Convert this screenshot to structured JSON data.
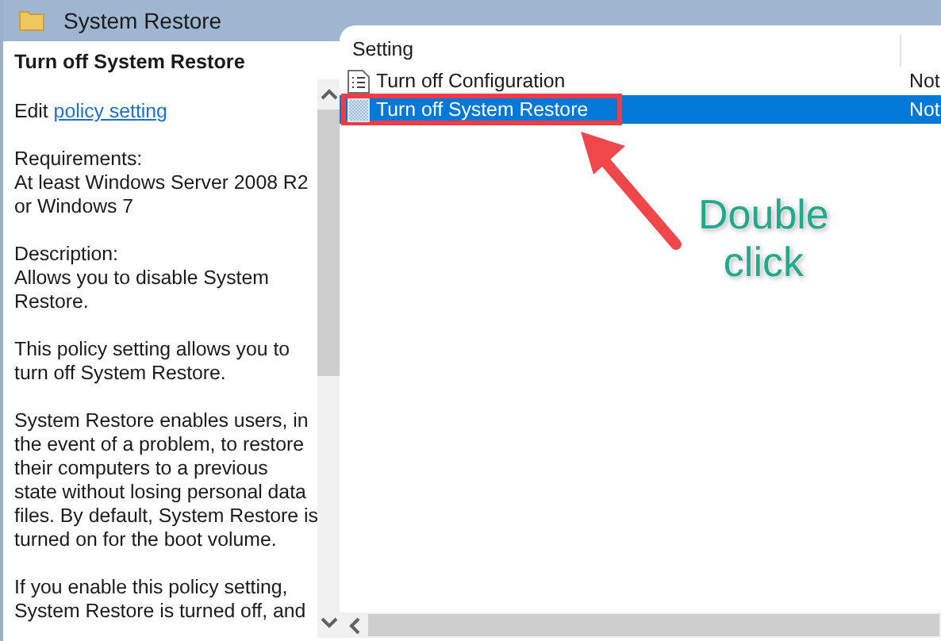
{
  "window": {
    "title": "System Restore"
  },
  "description_pane": {
    "heading": "Turn off System Restore",
    "edit_prefix": "Edit ",
    "edit_link": "policy setting",
    "paragraphs": [
      {
        "lines": [
          "Requirements:",
          "At least Windows Server 2008 R2",
          "or Windows 7"
        ]
      },
      {
        "lines": [
          "Description:",
          "Allows you to disable System",
          "Restore."
        ]
      },
      {
        "lines": [
          "This policy setting allows you to",
          "turn off System Restore."
        ]
      },
      {
        "lines": [
          "System Restore enables users, in",
          "the event of a problem, to restore",
          "their computers to a previous",
          "state without losing personal data",
          "files. By default, System Restore is",
          "turned on for the boot volume."
        ]
      },
      {
        "lines": [
          "If you enable this policy setting,",
          "System Restore is turned off, and"
        ]
      }
    ]
  },
  "settings_list": {
    "column_1": "Setting",
    "rows": [
      {
        "name": "Turn off Configuration",
        "column_3": "Not",
        "selected": false
      },
      {
        "name": "Turn off System Restore",
        "column_3": "Not",
        "selected": true
      }
    ]
  },
  "annotation": {
    "lines": [
      "Double",
      "click"
    ]
  }
}
